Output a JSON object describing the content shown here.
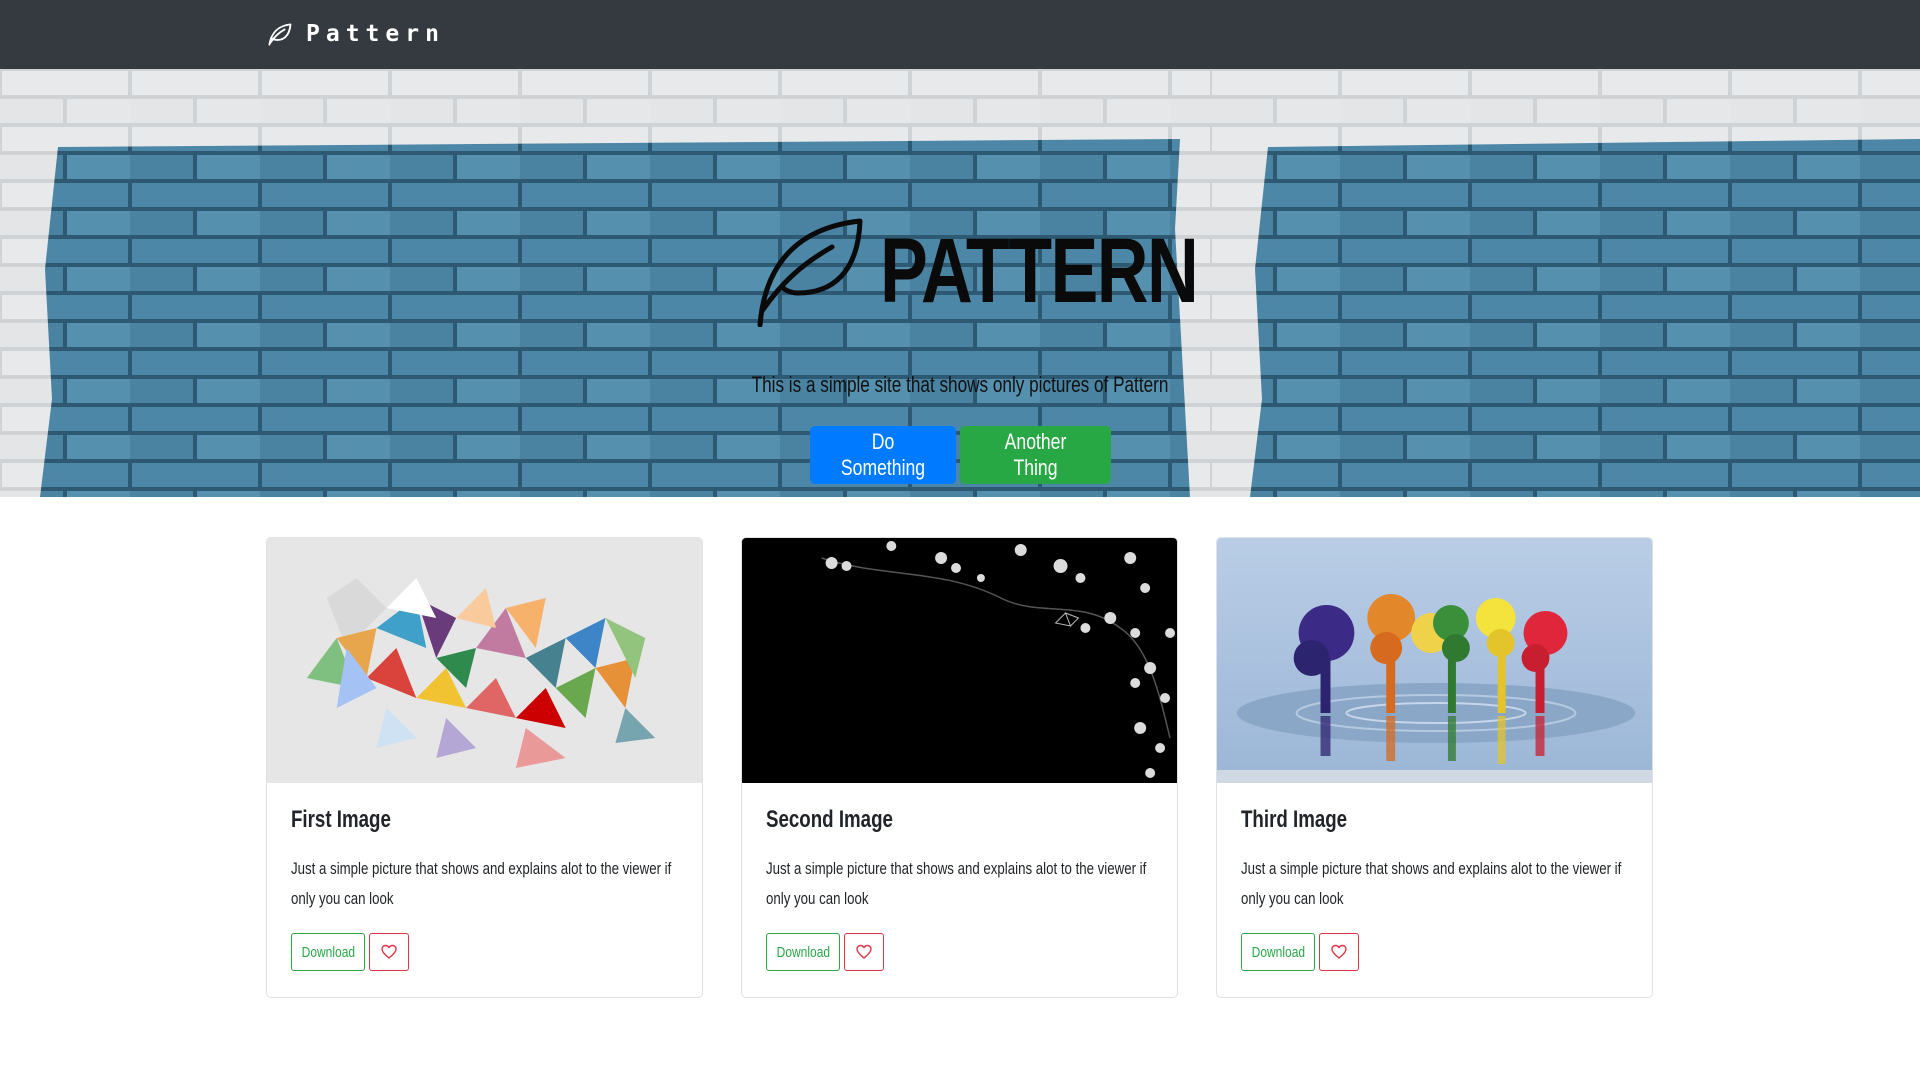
{
  "navbar": {
    "brand_text": "Pattern",
    "brand_icon": "leaf-icon"
  },
  "hero": {
    "title": "PATTERN",
    "logo_icon": "leaf-icon",
    "lead": "This is a simple site that shows only pictures of Pattern",
    "buttons": {
      "primary_label": "Do Something",
      "secondary_label": "Another Thing"
    }
  },
  "cards": [
    {
      "title": "First Image",
      "text": "Just a simple picture that shows and explains alot to the viewer if only you can look",
      "download_label": "Download",
      "like_icon": "heart-icon"
    },
    {
      "title": "Second Image",
      "text": "Just a simple picture that shows and explains alot to the viewer if only you can look",
      "download_label": "Download",
      "like_icon": "heart-icon"
    },
    {
      "title": "Third Image",
      "text": "Just a simple picture that shows and explains alot to the viewer if only you can look",
      "download_label": "Download",
      "like_icon": "heart-icon"
    }
  ],
  "colors": {
    "navbar_bg": "#343a40",
    "primary": "#007bff",
    "success": "#28a745",
    "danger": "#dc3545",
    "brick_blue": "#4a85a6"
  }
}
